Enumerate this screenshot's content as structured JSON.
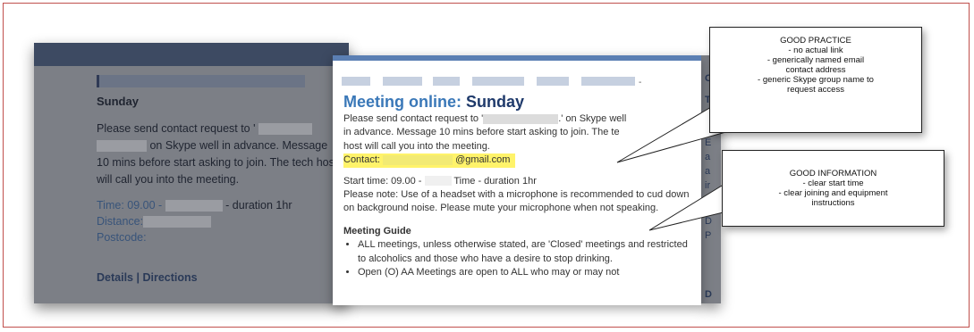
{
  "background_page": {
    "day": "Sunday",
    "request_prefix": "Please send contact request to '",
    "request_rest": "on Skype well in advance. Message 10 mins before start asking to join. The tech host will call you into the meeting.",
    "time_label": "Time: 09.00 -",
    "time_rest": "- duration 1hr",
    "distance_label": "Distance:",
    "postcode_label": "Postcode:",
    "details_link": "Details",
    "separator": "|",
    "directions_link": "Directions"
  },
  "modal": {
    "title_prefix": "Meeting online",
    "title_colon": ":",
    "title_day": "Sunday",
    "request_line_a": "Please send contact request to '",
    "request_line_b": ".' on Skype well",
    "request_line_c": "in advance. Message 10 mins before start asking to join. The te",
    "request_line_d": "host will call you into the meeting.",
    "contact_label": "Contact:",
    "contact_email_suffix": "@gmail.com",
    "start_time_label": "Start time: 09.00 -",
    "start_time_rest": "Time - duration 1hr",
    "note": "Please note: Use of a headset with a microphone is recommended to cud down on background noise. Please mute your microphone when not speaking.",
    "guide_heading": "Meeting Guide",
    "guide_items": [
      "ALL meetings, unless otherwise stated, are 'Closed' meetings and restricted to alcoholics and those who have a desire to stop drinking.",
      "Open (O) AA Meetings are open to ALL who may or may not"
    ]
  },
  "callouts": {
    "practice": {
      "title": "GOOD PRACTICE",
      "lines": [
        "- no actual link",
        "- generically named email",
        "contact address",
        "- generic Skype group name to",
        "request access"
      ]
    },
    "information": {
      "title": "GOOD INFORMATION",
      "lines": [
        "- clear start time",
        "- clear joining and equipment",
        "instructions"
      ]
    }
  },
  "colors": {
    "highlight": "#fff36a",
    "title_blue": "#3a78b8",
    "frame_red": "#c0504d"
  }
}
